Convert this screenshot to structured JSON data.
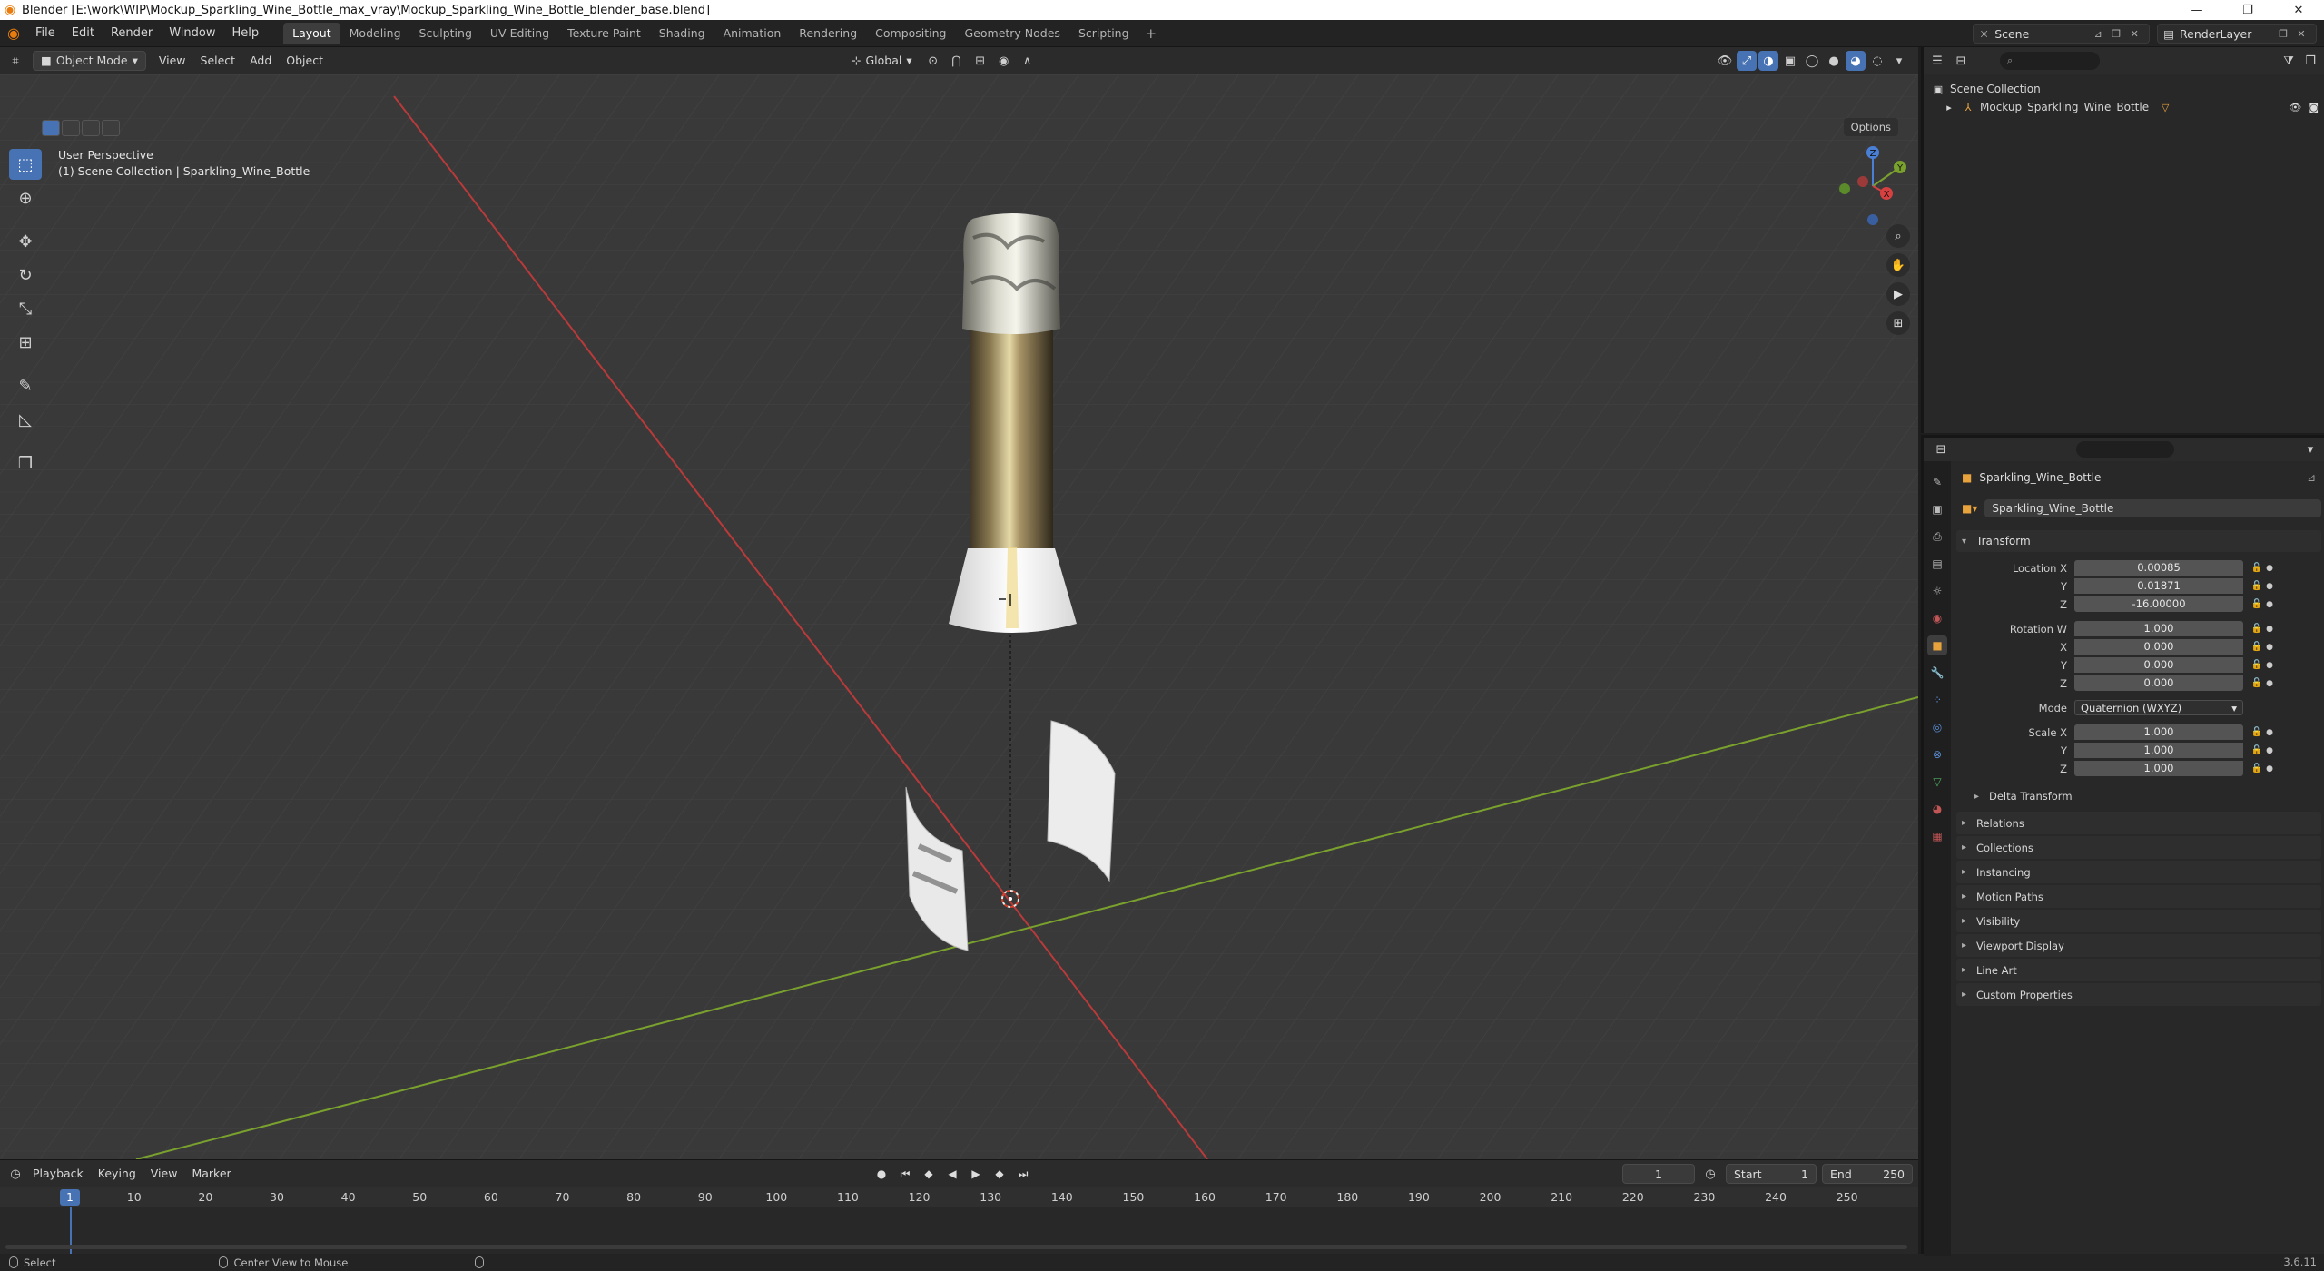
{
  "titlebar": {
    "title": "Blender [E:\\work\\WIP\\Mockup_Sparkling_Wine_Bottle_max_vray\\Mockup_Sparkling_Wine_Bottle_blender_base.blend]",
    "minimize": "—",
    "maximize": "❐",
    "close": "✕"
  },
  "menu": {
    "file": "File",
    "edit": "Edit",
    "render": "Render",
    "window": "Window",
    "help": "Help"
  },
  "workspaces": [
    {
      "label": "Layout",
      "active": true
    },
    {
      "label": "Modeling",
      "active": false
    },
    {
      "label": "Sculpting",
      "active": false
    },
    {
      "label": "UV Editing",
      "active": false
    },
    {
      "label": "Texture Paint",
      "active": false
    },
    {
      "label": "Shading",
      "active": false
    },
    {
      "label": "Animation",
      "active": false
    },
    {
      "label": "Rendering",
      "active": false
    },
    {
      "label": "Compositing",
      "active": false
    },
    {
      "label": "Geometry Nodes",
      "active": false
    },
    {
      "label": "Scripting",
      "active": false
    }
  ],
  "scene": {
    "name": "Scene",
    "view_layer": "RenderLayer"
  },
  "viewport": {
    "mode": "Object Mode",
    "menu_view": "View",
    "menu_select": "Select",
    "menu_add": "Add",
    "menu_object": "Object",
    "orientation": "Global",
    "options": "Options",
    "perspective": "User Perspective",
    "collection_path": "(1) Scene Collection | Sparkling_Wine_Bottle",
    "colors": {
      "background": "#393939",
      "grid": "#444444",
      "x_axis": "#b83a3a",
      "y_axis": "#7aa12d",
      "selection": "#4772b3"
    }
  },
  "gizmo": {
    "x": "X",
    "y": "Y",
    "z": "Z"
  },
  "timeline": {
    "playback": "Playback",
    "keying": "Keying",
    "view": "View",
    "marker": "Marker",
    "current_frame": "1",
    "start_label": "Start",
    "start": "1",
    "end_label": "End",
    "end": "250",
    "ruler": [
      "1",
      "10",
      "20",
      "30",
      "40",
      "50",
      "60",
      "70",
      "80",
      "90",
      "100",
      "110",
      "120",
      "130",
      "140",
      "150",
      "160",
      "170",
      "180",
      "190",
      "200",
      "210",
      "220",
      "230",
      "240",
      "250"
    ]
  },
  "status": {
    "select": "Select",
    "center_view": "Center View to Mouse",
    "version": "3.6.11"
  },
  "outliner": {
    "root": "Scene Collection",
    "object": "Mockup_Sparkling_Wine_Bottle"
  },
  "properties": {
    "object_name": "Sparkling_Wine_Bottle",
    "datablock_name": "Sparkling_Wine_Bottle",
    "transform_label": "Transform",
    "location_label": "Location X",
    "location": {
      "x": "0.00085",
      "y": "0.01871",
      "z": "-16.00000"
    },
    "rotation_label": "Rotation W",
    "rotation": {
      "w": "1.000",
      "x": "0.000",
      "y": "0.000",
      "z": "0.000"
    },
    "mode_label": "Mode",
    "mode_value": "Quaternion (WXYZ)",
    "scale_label": "Scale X",
    "scale": {
      "x": "1.000",
      "y": "1.000",
      "z": "1.000"
    },
    "axis_y": "Y",
    "axis_z": "Z",
    "axis_x": "X",
    "delta_transform": "Delta Transform",
    "panels": [
      "Relations",
      "Collections",
      "Instancing",
      "Motion Paths",
      "Visibility",
      "Viewport Display",
      "Line Art",
      "Custom Properties"
    ]
  }
}
